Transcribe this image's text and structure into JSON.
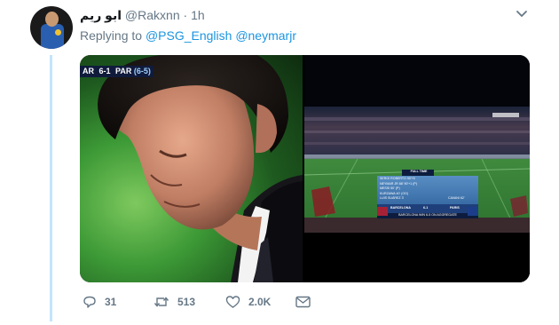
{
  "tweet": {
    "display_name": "ابو ريم",
    "handle": "@Rakxnn",
    "separator": "·",
    "time": "1h",
    "replying_prefix": "Replying to",
    "mentions": [
      "@PSG_English",
      "@neymarjr"
    ]
  },
  "media": {
    "left_score_bug": {
      "team1": "AR",
      "score": "6-1",
      "team2": "PAR",
      "aggregate": "(6-5)"
    },
    "right_graphic": {
      "badge": "FULL TIME",
      "scorers": [
        "SERGI ROBERTO  90'+5",
        "NEYMAR JR  88' 90'+1 (P)",
        "MESSI  50' (P)",
        "KURZAWA  40' (OG)",
        "LUIS SUÁREZ  3'"
      ],
      "away_scorer": "CAVANI  62'",
      "home_team": "BARCELONA",
      "score": "6-1",
      "away_team": "PARIS",
      "footer": "BARCELONA WIN 6-5 ON AGGREGATE"
    }
  },
  "actions": {
    "replies": "31",
    "retweets": "513",
    "likes": "2.0K"
  },
  "colors": {
    "link": "#1b95e0",
    "muted": "#657786",
    "thread_line": "#c4e4fb"
  }
}
